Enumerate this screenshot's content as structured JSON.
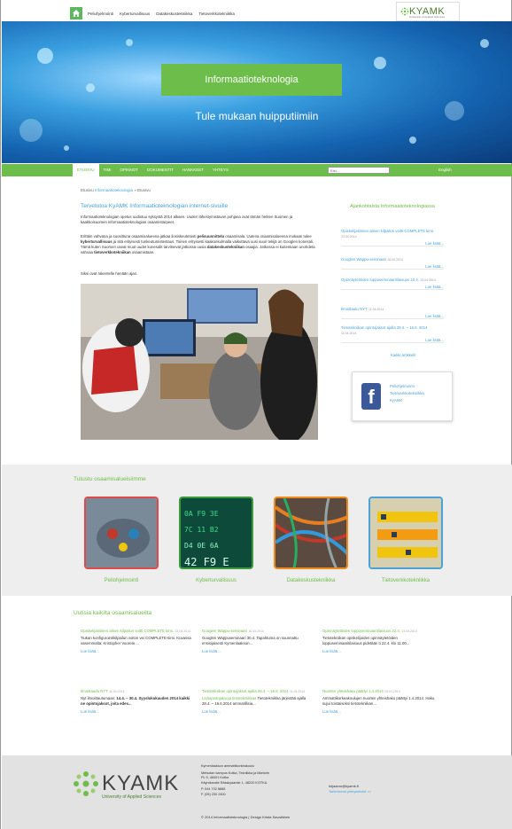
{
  "topnav": {
    "items": [
      "Peliohjelmointi",
      "Kyberturvallisuus",
      "Datakeskustekniikka",
      "Tietoverkkotekniikka"
    ]
  },
  "logo": {
    "name": "KYAMK",
    "subtitle": "University of Applied Sciences"
  },
  "hero": {
    "title": "Informaatioteknologia",
    "subtitle": "Tule mukaan huipputiimiin"
  },
  "mainnav": {
    "items": [
      "ETUSIVU",
      "TIMI",
      "OPINNOT",
      "DOKUMENTIT",
      "HANKKEET",
      "YHTEYS"
    ],
    "search_placeholder": "Etsi...",
    "language": "English"
  },
  "breadcrumb": {
    "home": "Etusivu",
    "section": "Informaatioteknologia",
    "sep": "»",
    "current": "Etusivu"
  },
  "intro": {
    "title": "Tervetuloa KyAMK Informaatioteknologian internet-sivuille",
    "p1": "Informaatioteknologian opetus uudistuu syksystä 2014 alkaen. Uuden lähestymistavan pohjana ovat tämän hetken Suomen ja kaakkoisuomen informaatioteknologian osaamistarpeet.",
    "p2_a": "Erittäin vahvana ja suosittuna osaamisalueena jatkaa ilosiskeutetusti ",
    "p2_b": "pelisuunnittelu",
    "p2_c": " osaamisala. Uutena osaamisalueena mukaan tulee ",
    "p2_d": "kyberturvallisuus",
    "p2_e": " ja sitä erityisesti tunkeutumistestaus. Toinen erityisesti kaakonkulmalla vaikuttava uusi suuri tekijä on Googlen konesali. Tämä kuten Suomen useat muut uudet konesalit tarvitsevat jatkossa uusia ",
    "p2_f": "datakeskustekniikan",
    "p2_g": " osaajia. Jatkossa ei kuitenkaan unohdeta vahvaa ",
    "p2_h": "tietoverkkotekniikan",
    "p2_i": " osaamistaan.",
    "p3": "Siksi ovat rakentelle henään ajan."
  },
  "sidebar": {
    "heading": "Ajankohtaista Informaatioteknologiassa",
    "items": [
      {
        "title": "Opiskelijatiimien alisen kilpailun voitti COMPLETE tiimi.",
        "date": "23.04.2014",
        "more": "Lue lisää..."
      },
      {
        "title": "Googlen Wappu-seminaari",
        "date": "16.04.2014",
        "more": "Lue lisää..."
      },
      {
        "title": "Opinnäytetöiden loppuseminaaritilaisuus 22.4.",
        "date": "13.04.2014",
        "more": "Lue lisää..."
      },
      {
        "title": "Ilmoittautu NYT",
        "date": "11.04.2014",
        "more": "Lue lisää..."
      },
      {
        "title": "Tietotekniikan opintojaksot ajalla 28.4. – 16.6. 2014",
        "date": "11.04.2014",
        "more": "Lue lisää..."
      }
    ],
    "all": "Kaikki artikkelit",
    "fb_links": [
      "Peliohjelmointi",
      "Tietoverkkotekniikka",
      "KyAMK"
    ]
  },
  "competences": {
    "heading": "Tutustu osaamisalueisiimme",
    "tiles": [
      {
        "label": "Peliohjelmointi",
        "border": "#e04a4a"
      },
      {
        "label": "Kyberturvallisuus",
        "border": "#3b9a3b"
      },
      {
        "label": "Datakeskustekniikka",
        "border": "#f08a1c"
      },
      {
        "label": "Tietoverkkotekniikka",
        "border": "#4aa2d6"
      }
    ]
  },
  "news": {
    "heading": "Uutisia kaikilta osaamisalueilta",
    "items": [
      {
        "title": "Opiskelijatiimien alisen kilpailun voitti COMPLETE tiimi.",
        "date": "23.04.2014",
        "body": "Tiukan konfigurointikilpailun voiton vei COMPLETE-tiimi. Kuvassa vasemmalta: Kristopher Vuorela ...",
        "more": "Lue lisää..."
      },
      {
        "title": "Googlen Wappu-seminaari",
        "date": "16.04.2014",
        "body": "Googlen Wappuseminaari 30.4. Tapahtuma on suunnattu ensisijaisesti Kymenlaakson...",
        "more": "Lue lisää..."
      },
      {
        "title": "Opinnäytetöiden loppuseminaaritilaisuus 22.4.",
        "date": "13.04.2014",
        "body": "Tietotekniikan opiskelijoiden opinnäytetöiden loppuseminaaritilaisuus pidetään ti 22.4. klo 11.00...",
        "more": "Lue lisää..."
      },
      {
        "title": "Ilmoittaudu NYT",
        "date": "11.04.2014",
        "body_a": "Nyt ilmoittautumaan: ",
        "body_b": "14.4. – 30.4. Syyslukukauden 2014 kaikki ne opintojaksot, joita edes...",
        "more": "Lue lisää..."
      },
      {
        "title": "Tietotekniikan opintojaksot ajalla 28.4. – 16.6. 2014",
        "date": "11.04.2014",
        "body_a": "Lisäopintojaksoja tietotekniikkaa",
        "body_b": " Tietotekniikka järjestää ajalla 28.4. – 16.6.2014 ammatillisia...",
        "more": "Lue lisää..."
      },
      {
        "title": "Nuorten yhteishaku päättyi 1.4.2014",
        "date": "03.04.2014",
        "body": "Ammattikorkeakoulujen nuorten yhteishaku päättyi 1.4.2014. Haku sujui toistaiseksi tietotekniikan...",
        "more": "Lue lisää..."
      }
    ]
  },
  "footer": {
    "logo_word": "KYAMK",
    "logo_sub": "University of Applied Sciences",
    "org": "Kymenlaakson ammattikorkeakoulu",
    "addr1": "Metsolan kampus Kotka, Tekniikka ja liiketoim",
    "addr2": "PL 9, 48401 Kotka",
    "addr3": "Käyntiosoite Rässkyaantie 1, 48220 KOTKA",
    "phone": "P. 044 702 8888",
    "fax": "F. (05) 230 2400",
    "email": "kirjaamo@kyamk.fi",
    "contact_link": "Tarkemmat yhteystiedot >>",
    "copyright": "© 2014 Informaatioteknologia | Design Krista Savaläinen"
  }
}
